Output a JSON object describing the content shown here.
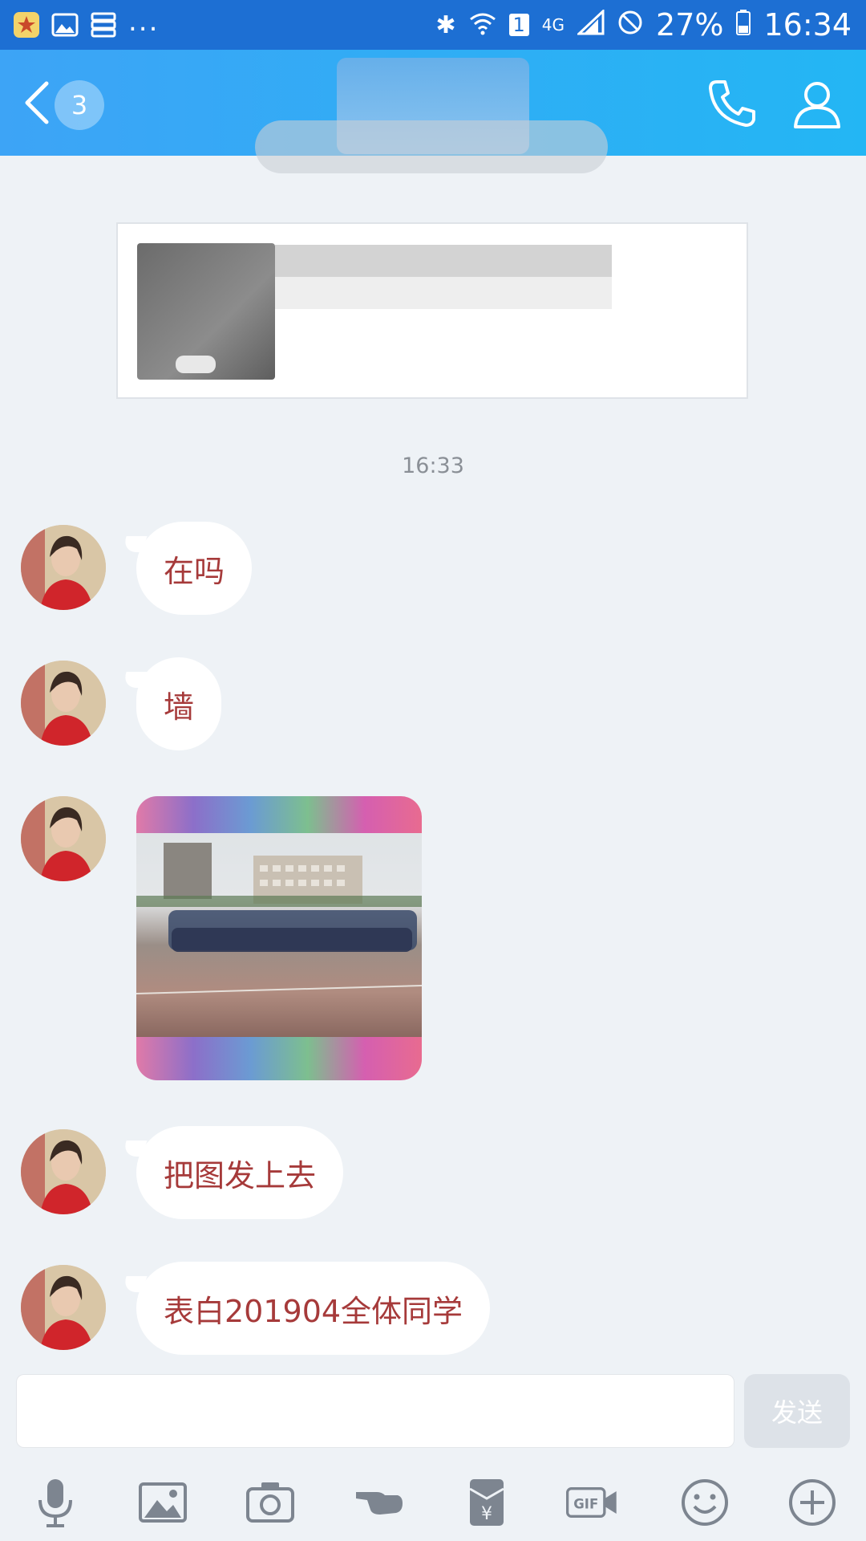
{
  "status_bar": {
    "more": "...",
    "network": "4G",
    "sim": "1",
    "battery": "27%",
    "time": "16:34"
  },
  "header": {
    "unread_count": "3"
  },
  "conversation": {
    "time_divider": "16:33",
    "messages": [
      {
        "text": "在吗"
      },
      {
        "text": "墙"
      },
      {
        "text": "把图发上去"
      },
      {
        "text": "表白201904全体同学"
      }
    ]
  },
  "input": {
    "send_label": "发送",
    "gif_label": "GIF"
  }
}
